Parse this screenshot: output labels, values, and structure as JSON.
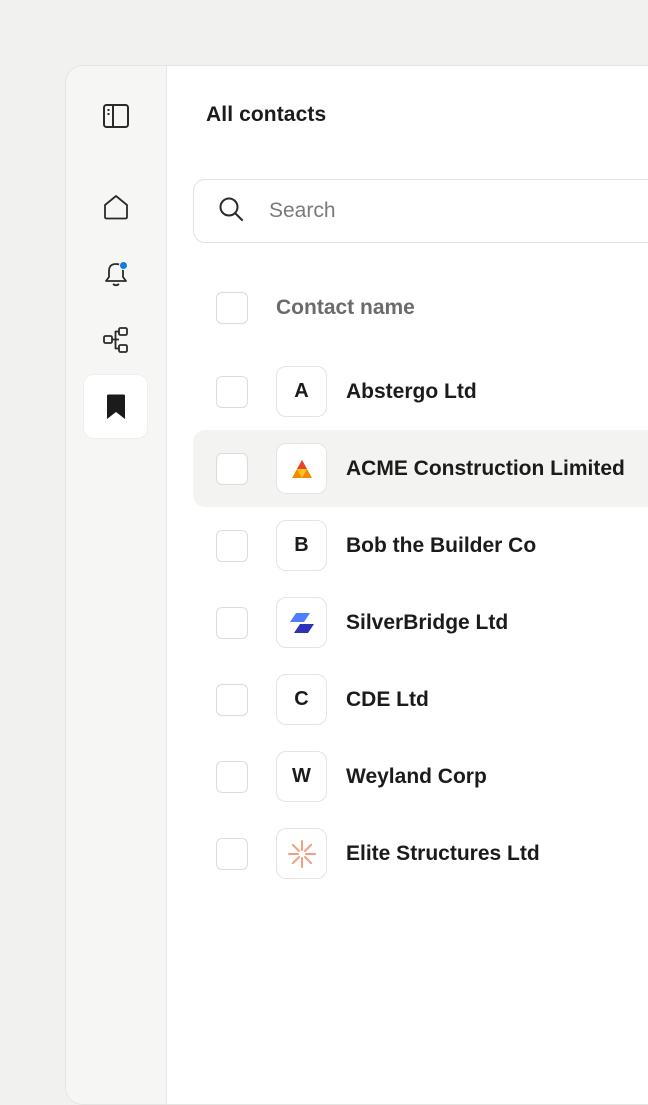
{
  "page": {
    "title": "All contacts"
  },
  "search": {
    "placeholder": "Search"
  },
  "table": {
    "column_header": "Contact name"
  },
  "sidebar": {
    "items": [
      {
        "name": "sidebar-toggle",
        "icon": "sidebar-panel-icon"
      },
      {
        "name": "home",
        "icon": "home-icon"
      },
      {
        "name": "notifications",
        "icon": "bell-icon",
        "badge_color": "#1479e0"
      },
      {
        "name": "hierarchy",
        "icon": "hierarchy-icon"
      },
      {
        "name": "bookmarks",
        "icon": "bookmark-icon",
        "active": true
      }
    ]
  },
  "contacts": [
    {
      "name": "Abstergo Ltd",
      "avatar": "A"
    },
    {
      "name": "ACME Construction Limited",
      "avatar": "",
      "logo": "acme-cone-logo"
    },
    {
      "name": "Bob the Builder Co",
      "avatar": "B"
    },
    {
      "name": "SilverBridge Ltd",
      "avatar": "",
      "logo": "silverbridge-logo"
    },
    {
      "name": "CDE Ltd",
      "avatar": "C"
    },
    {
      "name": "Weyland Corp",
      "avatar": "W"
    },
    {
      "name": "Elite Structures Ltd",
      "avatar": "",
      "logo": "elite-structures-logo"
    }
  ],
  "colors": {
    "accent": "#1479e0",
    "hover_row": "#f3f3f1",
    "acme_orange": "#f08a00",
    "silverbridge_blue": "#3b4fd8",
    "elite_coral": "#f0a080"
  }
}
